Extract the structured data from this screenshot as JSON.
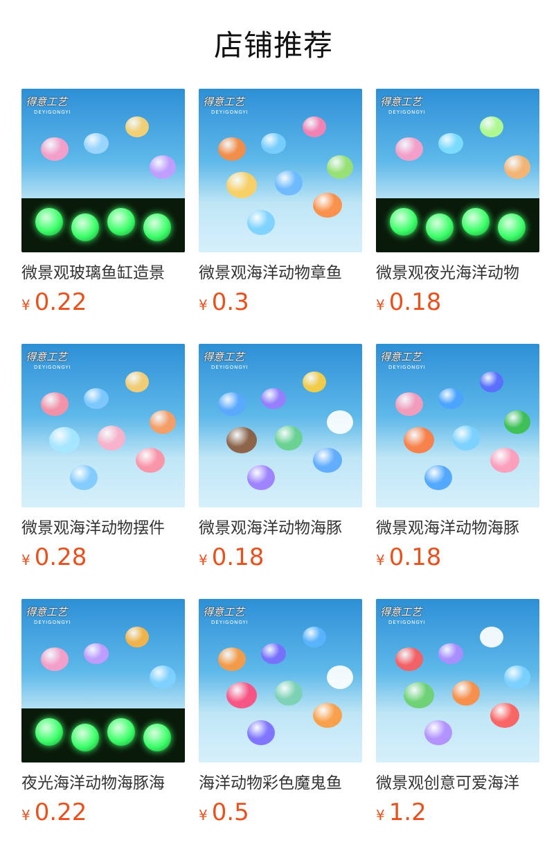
{
  "page": {
    "title": "店铺推荐"
  },
  "brand": {
    "logo_text": "得意工艺",
    "logo_sub": "DEYIGONGYI"
  },
  "currency": "¥",
  "colors": {
    "price": "#e8501c",
    "sand": "#bfe3f2",
    "water": "#3aa3dd",
    "glow": "#3dff6a"
  },
  "products": [
    {
      "name": "微景观玻璃鱼缸造景",
      "price": "0.22",
      "glow": true
    },
    {
      "name": "微景观海洋动物章鱼",
      "price": "0.3",
      "glow": false
    },
    {
      "name": "微景观夜光海洋动物",
      "price": "0.18",
      "glow": true
    },
    {
      "name": "微景观海洋动物摆件",
      "price": "0.28",
      "glow": false
    },
    {
      "name": "微景观海洋动物海豚",
      "price": "0.18",
      "glow": false
    },
    {
      "name": "微景观海洋动物海豚",
      "price": "0.18",
      "glow": false
    },
    {
      "name": "夜光海洋动物海豚海",
      "price": "0.22",
      "glow": true
    },
    {
      "name": "海洋动物彩色魔鬼鱼",
      "price": "0.5",
      "glow": false
    },
    {
      "name": "微景观创意可爱海洋",
      "price": "1.2",
      "glow": false
    }
  ]
}
